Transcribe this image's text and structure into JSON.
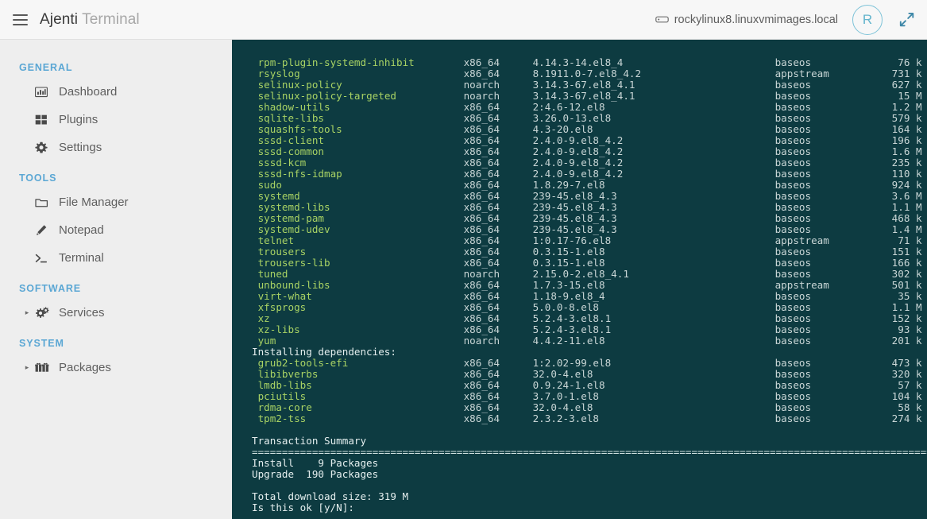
{
  "header": {
    "brand_main": "Ajenti",
    "brand_sub": "Terminal",
    "hostname": "rockylinux8.linuxvmimages.local",
    "avatar_initial": "R",
    "menu_icon": "hamburger-icon",
    "server_icon": "server-icon",
    "expand_icon": "fullscreen-expand-icon"
  },
  "sidebar": {
    "sections": [
      {
        "title": "GENERAL",
        "items": [
          {
            "label": "Dashboard",
            "icon": "chart-bar-icon",
            "caret": false
          },
          {
            "label": "Plugins",
            "icon": "grid-squares-icon",
            "caret": false
          },
          {
            "label": "Settings",
            "icon": "gear-icon",
            "caret": false
          }
        ]
      },
      {
        "title": "TOOLS",
        "items": [
          {
            "label": "File Manager",
            "icon": "folder-icon",
            "caret": false
          },
          {
            "label": "Notepad",
            "icon": "pencil-icon",
            "caret": false
          },
          {
            "label": "Terminal",
            "icon": "terminal-prompt-icon",
            "caret": false
          }
        ]
      },
      {
        "title": "SOFTWARE",
        "items": [
          {
            "label": "Services",
            "icon": "gears-icon",
            "caret": true
          }
        ]
      },
      {
        "title": "SYSTEM",
        "items": [
          {
            "label": "Packages",
            "icon": "gift-boxes-icon",
            "caret": true
          }
        ]
      }
    ]
  },
  "terminal": {
    "upgrade_rows": [
      {
        "name": "rpm-plugin-systemd-inhibit",
        "arch": "x86_64",
        "version": "4.14.3-14.el8_4",
        "repo": "baseos",
        "size": "76 k"
      },
      {
        "name": "rsyslog",
        "arch": "x86_64",
        "version": "8.1911.0-7.el8_4.2",
        "repo": "appstream",
        "size": "731 k"
      },
      {
        "name": "selinux-policy",
        "arch": "noarch",
        "version": "3.14.3-67.el8_4.1",
        "repo": "baseos",
        "size": "627 k"
      },
      {
        "name": "selinux-policy-targeted",
        "arch": "noarch",
        "version": "3.14.3-67.el8_4.1",
        "repo": "baseos",
        "size": "15 M"
      },
      {
        "name": "shadow-utils",
        "arch": "x86_64",
        "version": "2:4.6-12.el8",
        "repo": "baseos",
        "size": "1.2 M"
      },
      {
        "name": "sqlite-libs",
        "arch": "x86_64",
        "version": "3.26.0-13.el8",
        "repo": "baseos",
        "size": "579 k"
      },
      {
        "name": "squashfs-tools",
        "arch": "x86_64",
        "version": "4.3-20.el8",
        "repo": "baseos",
        "size": "164 k"
      },
      {
        "name": "sssd-client",
        "arch": "x86_64",
        "version": "2.4.0-9.el8_4.2",
        "repo": "baseos",
        "size": "196 k"
      },
      {
        "name": "sssd-common",
        "arch": "x86_64",
        "version": "2.4.0-9.el8_4.2",
        "repo": "baseos",
        "size": "1.6 M"
      },
      {
        "name": "sssd-kcm",
        "arch": "x86_64",
        "version": "2.4.0-9.el8_4.2",
        "repo": "baseos",
        "size": "235 k"
      },
      {
        "name": "sssd-nfs-idmap",
        "arch": "x86_64",
        "version": "2.4.0-9.el8_4.2",
        "repo": "baseos",
        "size": "110 k"
      },
      {
        "name": "sudo",
        "arch": "x86_64",
        "version": "1.8.29-7.el8",
        "repo": "baseos",
        "size": "924 k"
      },
      {
        "name": "systemd",
        "arch": "x86_64",
        "version": "239-45.el8_4.3",
        "repo": "baseos",
        "size": "3.6 M"
      },
      {
        "name": "systemd-libs",
        "arch": "x86_64",
        "version": "239-45.el8_4.3",
        "repo": "baseos",
        "size": "1.1 M"
      },
      {
        "name": "systemd-pam",
        "arch": "x86_64",
        "version": "239-45.el8_4.3",
        "repo": "baseos",
        "size": "468 k"
      },
      {
        "name": "systemd-udev",
        "arch": "x86_64",
        "version": "239-45.el8_4.3",
        "repo": "baseos",
        "size": "1.4 M"
      },
      {
        "name": "telnet",
        "arch": "x86_64",
        "version": "1:0.17-76.el8",
        "repo": "appstream",
        "size": "71 k"
      },
      {
        "name": "trousers",
        "arch": "x86_64",
        "version": "0.3.15-1.el8",
        "repo": "baseos",
        "size": "151 k"
      },
      {
        "name": "trousers-lib",
        "arch": "x86_64",
        "version": "0.3.15-1.el8",
        "repo": "baseos",
        "size": "166 k"
      },
      {
        "name": "tuned",
        "arch": "noarch",
        "version": "2.15.0-2.el8_4.1",
        "repo": "baseos",
        "size": "302 k"
      },
      {
        "name": "unbound-libs",
        "arch": "x86_64",
        "version": "1.7.3-15.el8",
        "repo": "appstream",
        "size": "501 k"
      },
      {
        "name": "virt-what",
        "arch": "x86_64",
        "version": "1.18-9.el8_4",
        "repo": "baseos",
        "size": "35 k"
      },
      {
        "name": "xfsprogs",
        "arch": "x86_64",
        "version": "5.0.0-8.el8",
        "repo": "baseos",
        "size": "1.1 M"
      },
      {
        "name": "xz",
        "arch": "x86_64",
        "version": "5.2.4-3.el8.1",
        "repo": "baseos",
        "size": "152 k"
      },
      {
        "name": "xz-libs",
        "arch": "x86_64",
        "version": "5.2.4-3.el8.1",
        "repo": "baseos",
        "size": "93 k"
      },
      {
        "name": "yum",
        "arch": "noarch",
        "version": "4.4.2-11.el8",
        "repo": "baseos",
        "size": "201 k"
      }
    ],
    "dependencies_header": "Installing dependencies:",
    "dependency_rows": [
      {
        "name": "grub2-tools-efi",
        "arch": "x86_64",
        "version": "1:2.02-99.el8",
        "repo": "baseos",
        "size": "473 k"
      },
      {
        "name": "libibverbs",
        "arch": "x86_64",
        "version": "32.0-4.el8",
        "repo": "baseos",
        "size": "320 k"
      },
      {
        "name": "lmdb-libs",
        "arch": "x86_64",
        "version": "0.9.24-1.el8",
        "repo": "baseos",
        "size": "57 k"
      },
      {
        "name": "pciutils",
        "arch": "x86_64",
        "version": "3.7.0-1.el8",
        "repo": "baseos",
        "size": "104 k"
      },
      {
        "name": "rdma-core",
        "arch": "x86_64",
        "version": "32.0-4.el8",
        "repo": "baseos",
        "size": "58 k"
      },
      {
        "name": "tpm2-tss",
        "arch": "x86_64",
        "version": "2.3.2-3.el8",
        "repo": "baseos",
        "size": "274 k"
      }
    ],
    "summary_title": "Transaction Summary",
    "summary_separator": "================================================================================================================================",
    "summary_lines": [
      "Install    9 Packages",
      "Upgrade  190 Packages"
    ],
    "total_download": "Total download size: 319 M",
    "prompt": "Is this ok [y/N]:"
  }
}
